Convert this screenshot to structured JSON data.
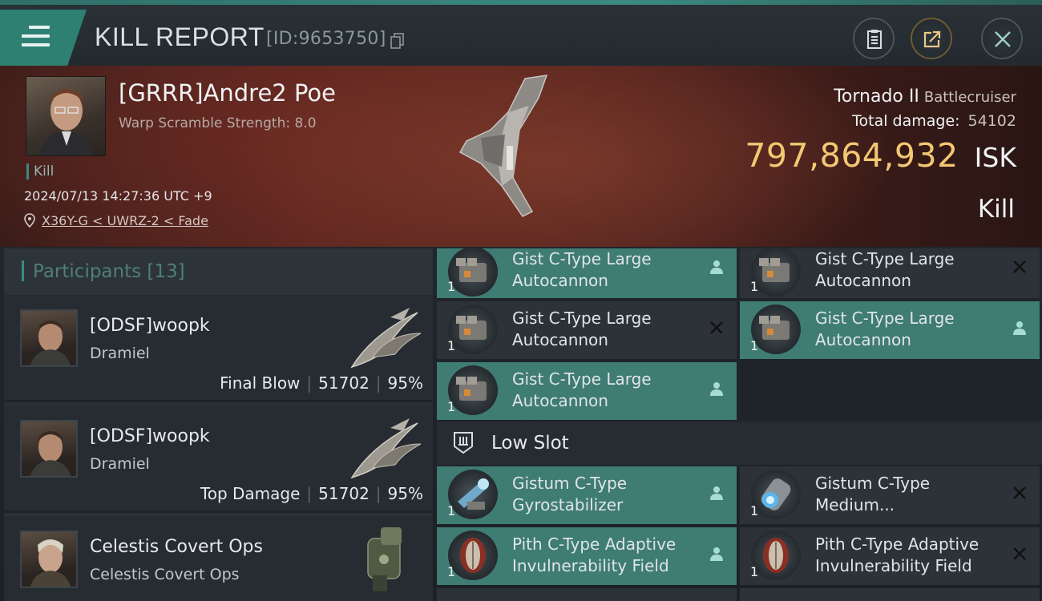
{
  "header": {
    "title": "KILL REPORT",
    "report_id": "[ID:9653750]",
    "menu_icon": "hamburger-menu-icon",
    "clipboard_icon": "clipboard-icon",
    "share_icon": "share-icon",
    "close_icon": "close-icon"
  },
  "victim": {
    "name": "[GRRR]Andre2 Poe",
    "warp_scramble": "Warp Scramble Strength: 8.0",
    "kill_tag": "Kill",
    "datetime": "2024/07/13 14:27:36 UTC +9",
    "location": "X36Y-G < UWRZ-2 < Fade"
  },
  "ship": {
    "name": "Tornado II",
    "class": "Battlecruiser",
    "total_damage_label": "Total damage:",
    "total_damage": "54102",
    "isk_amount": "797,864,932",
    "isk_currency": "ISK",
    "result": "Kill"
  },
  "participants": {
    "label": "Participants",
    "count": "[13]",
    "rows": [
      {
        "name": "[ODSF]woopk",
        "ship": "Dramiel",
        "role": "Final Blow",
        "damage": "51702",
        "percent": "95%"
      },
      {
        "name": "[ODSF]woopk",
        "ship": "Dramiel",
        "role": "Top Damage",
        "damage": "51702",
        "percent": "95%"
      },
      {
        "name": "Celestis Covert Ops",
        "ship": "Celestis Covert Ops",
        "role": "",
        "damage": "",
        "percent": ""
      }
    ]
  },
  "modules": {
    "high": [
      {
        "name": "Gist C-Type Large Autocannon",
        "qty": "1",
        "state": "dropped"
      },
      {
        "name": "Gist C-Type Large Autocannon",
        "qty": "1",
        "state": "destroyed"
      },
      {
        "name": "Gist C-Type Large Autocannon",
        "qty": "1",
        "state": "destroyed"
      },
      {
        "name": "Gist C-Type Large Autocannon",
        "qty": "1",
        "state": "dropped"
      },
      {
        "name": "Gist C-Type Large Autocannon",
        "qty": "1",
        "state": "dropped"
      }
    ],
    "low_slot_label": "Low Slot",
    "low": [
      {
        "name": "Gistum C-Type Gyrostabilizer",
        "qty": "1",
        "state": "dropped"
      },
      {
        "name": "Gistum C-Type Medium...",
        "qty": "1",
        "state": "destroyed"
      },
      {
        "name": "Pith C-Type Adaptive Invulnerability Field",
        "qty": "1",
        "state": "dropped"
      },
      {
        "name": "Pith C-Type Adaptive Invulnerability Field",
        "qty": "1",
        "state": "destroyed"
      }
    ]
  },
  "colors": {
    "accent": "#3b8a80",
    "isk": "#f3c872",
    "dropped_bg": "#3f7c73",
    "destroyed_bg": "#2c3237"
  }
}
